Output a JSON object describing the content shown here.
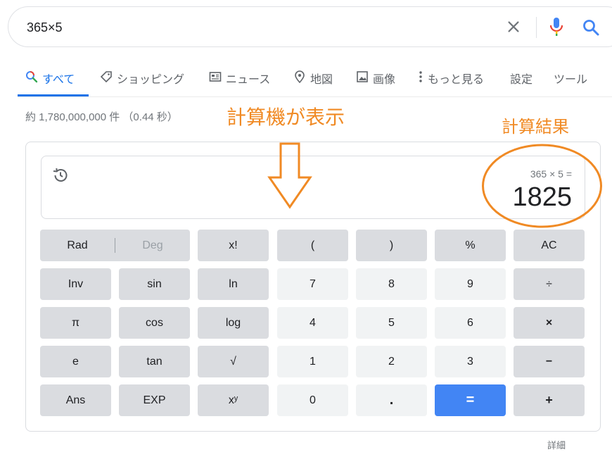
{
  "search": {
    "query": "365×5"
  },
  "tabs": [
    {
      "label": "すべて",
      "icon": "search-icon"
    },
    {
      "label": "ショッピング",
      "icon": "tag-icon"
    },
    {
      "label": "ニュース",
      "icon": "news-icon"
    },
    {
      "label": "地図",
      "icon": "map-pin-icon"
    },
    {
      "label": "画像",
      "icon": "image-icon"
    },
    {
      "label": "もっと見る",
      "icon": "more-vert-icon"
    },
    {
      "label": "設定"
    },
    {
      "label": "ツール"
    }
  ],
  "result_stats": "約 1,780,000,000 件 （0.44 秒）",
  "annotations": {
    "calculator": "計算機が表示",
    "result": "計算結果"
  },
  "calculator": {
    "expression": "365 × 5 =",
    "result": "1825",
    "keys": {
      "rad": "Rad",
      "deg": "Deg",
      "fact": "x!",
      "lparen": "(",
      "rparen": ")",
      "percent": "%",
      "ac": "AC",
      "inv": "Inv",
      "sin": "sin",
      "ln": "ln",
      "k7": "7",
      "k8": "8",
      "k9": "9",
      "divide": "÷",
      "pi": "π",
      "cos": "cos",
      "log": "log",
      "k4": "4",
      "k5": "5",
      "k6": "6",
      "multiply": "×",
      "e": "e",
      "tan": "tan",
      "sqrt": "√",
      "k1": "1",
      "k2": "2",
      "k3": "3",
      "minus": "−",
      "ans": "Ans",
      "exp": "EXP",
      "pow": "xʸ",
      "k0": "0",
      "dot": ".",
      "equals": "=",
      "plus": "+"
    },
    "details": "詳細"
  },
  "colors": {
    "accent": "#1a73e8",
    "annotation": "#f08a24",
    "equals_key": "#4285f4"
  }
}
